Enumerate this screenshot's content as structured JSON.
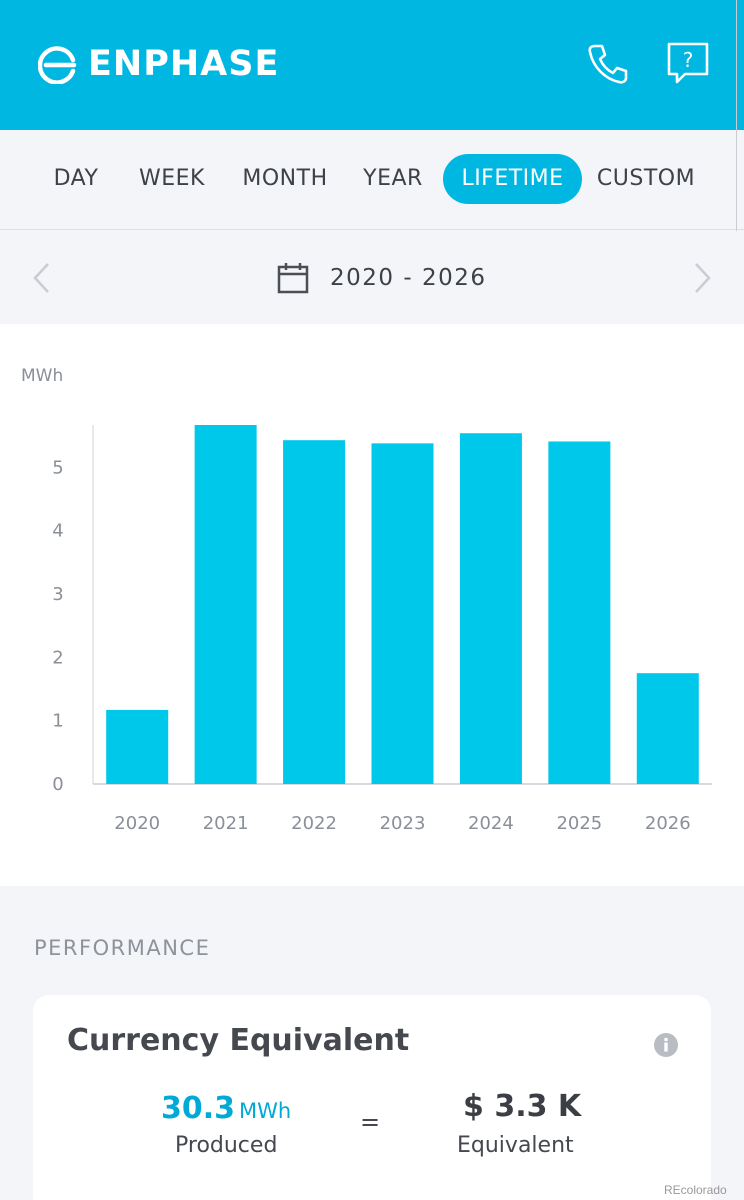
{
  "brand": {
    "name": "ENPHASE",
    "color": "#00b7e1"
  },
  "header_icons": [
    "phone-icon",
    "help-icon"
  ],
  "tabs": [
    {
      "label": "DAY"
    },
    {
      "label": "WEEK"
    },
    {
      "label": "MONTH"
    },
    {
      "label": "YEAR"
    },
    {
      "label": "LIFETIME",
      "active": true
    },
    {
      "label": "CUSTOM"
    }
  ],
  "date_nav": {
    "range": "2020 - 2026"
  },
  "chart_data": {
    "type": "bar",
    "ylabel": "MWh",
    "categories": [
      "2020",
      "2021",
      "2022",
      "2023",
      "2024",
      "2025",
      "2026"
    ],
    "values": [
      1.17,
      5.67,
      5.43,
      5.38,
      5.54,
      5.41,
      1.75
    ],
    "ylim": [
      0,
      5.67
    ],
    "yticks": [
      0,
      1,
      2,
      3,
      4,
      5
    ],
    "grid": false,
    "bar_color": "#00c8ea"
  },
  "performance": {
    "section_label": "PERFORMANCE",
    "card_title": "Currency Equivalent",
    "produced_value": "30.3",
    "produced_unit": "MWh",
    "produced_label": "Produced",
    "equals": "=",
    "equivalent_value": "$ 3.3 K",
    "equivalent_label": "Equivalent"
  },
  "watermark": "REcolorado"
}
